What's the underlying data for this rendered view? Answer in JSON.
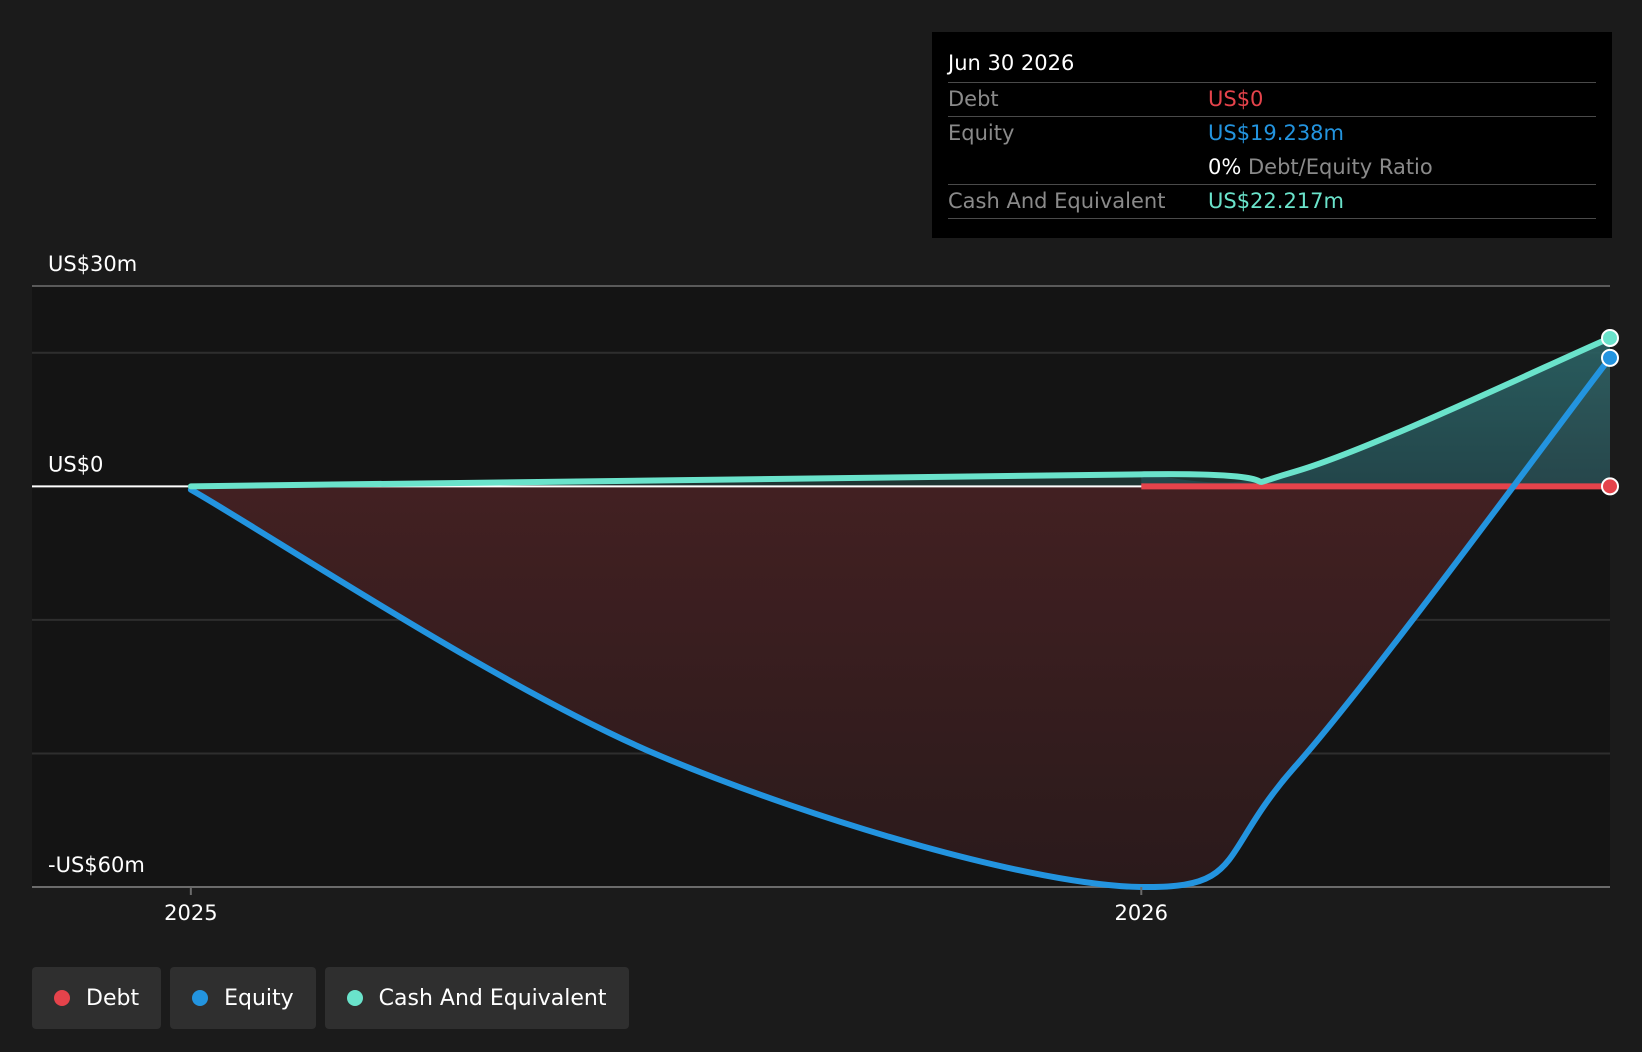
{
  "chart_data": {
    "type": "area",
    "y_axis": {
      "min": -60,
      "max": 30,
      "unit": "US$m",
      "tick_labels": [
        {
          "value": 30,
          "text": "US$30m"
        },
        {
          "value": 0,
          "text": "US$0"
        },
        {
          "value": -60,
          "text": "-US$60m"
        }
      ],
      "gridlines": [
        30,
        20,
        0,
        -20,
        -40,
        -60
      ]
    },
    "x_axis": {
      "min": "2024-11-01",
      "max": "2026-06-30",
      "tick_labels": [
        {
          "date": "2025-01-01",
          "text": "2025"
        },
        {
          "date": "2026-01-01",
          "text": "2026"
        }
      ]
    },
    "series": [
      {
        "name": "Debt",
        "color": "#e5434b",
        "points": [
          [
            "2026-01-01",
            0
          ],
          [
            "2026-06-30",
            0
          ]
        ]
      },
      {
        "name": "Equity",
        "color": "#2394df",
        "points": [
          [
            "2025-01-01",
            -0.5
          ],
          [
            "2025-07-01",
            -40.5
          ],
          [
            "2026-01-01",
            -60
          ],
          [
            "2026-03-01",
            -42
          ],
          [
            "2026-06-30",
            19.238
          ]
        ]
      },
      {
        "name": "Cash And Equivalent",
        "color": "#6ae3cb",
        "points": [
          [
            "2025-01-01",
            0
          ],
          [
            "2026-01-01",
            1.8
          ],
          [
            "2026-03-01",
            2.2
          ],
          [
            "2026-06-30",
            22.217
          ]
        ]
      }
    ],
    "legend_position": "bottom-left"
  },
  "tooltip": {
    "date": "Jun 30 2026",
    "debt_label": "Debt",
    "debt_value": "US$0",
    "equity_label": "Equity",
    "equity_value": "US$19.238m",
    "ratio_value": "0%",
    "ratio_label": "Debt/Equity Ratio",
    "cash_label": "Cash And Equivalent",
    "cash_value": "US$22.217m"
  },
  "legend": {
    "items": [
      {
        "label": "Debt",
        "color": "#e5434b"
      },
      {
        "label": "Equity",
        "color": "#2394df"
      },
      {
        "label": "Cash And Equivalent",
        "color": "#6ae3cb"
      }
    ]
  }
}
